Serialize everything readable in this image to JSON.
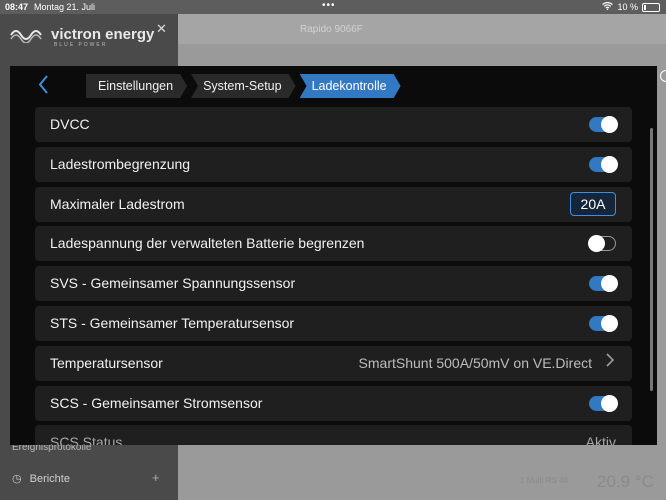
{
  "status": {
    "time": "08:47",
    "date": "Montag 21. Juli",
    "battery": "10 %"
  },
  "background": {
    "brand": "victron energy",
    "brand_sub": "BLUE POWER",
    "title": "Rapido 9066F",
    "menu_item_1": "Ereignisprotokolle",
    "menu_item_2": "Berichte",
    "temp_value": "20.9 °C",
    "temp_small": "1 Multi RS 48"
  },
  "breadcrumbs": [
    "Einstellungen",
    "System-Setup",
    "Ladekontrolle"
  ],
  "settings": [
    {
      "label": "DVCC",
      "type": "toggle",
      "on": true
    },
    {
      "label": "Ladestrombegrenzung",
      "type": "toggle",
      "on": true
    },
    {
      "label": "Maximaler Ladestrom",
      "type": "value",
      "value": "20A"
    },
    {
      "label": "Ladespannung der verwalteten Batterie begrenzen",
      "type": "toggle",
      "on": false
    },
    {
      "label": "SVS - Gemeinsamer Spannungssensor",
      "type": "toggle",
      "on": true
    },
    {
      "label": "STS - Gemeinsamer Temperatursensor",
      "type": "toggle",
      "on": true
    },
    {
      "label": "Temperatursensor",
      "type": "link",
      "value": "SmartShunt 500A/50mV on VE.Direct"
    },
    {
      "label": "SCS - Gemeinsamer Stromsensor",
      "type": "toggle",
      "on": true
    },
    {
      "label": "SCS Status",
      "type": "text",
      "value": "Aktiv"
    }
  ]
}
